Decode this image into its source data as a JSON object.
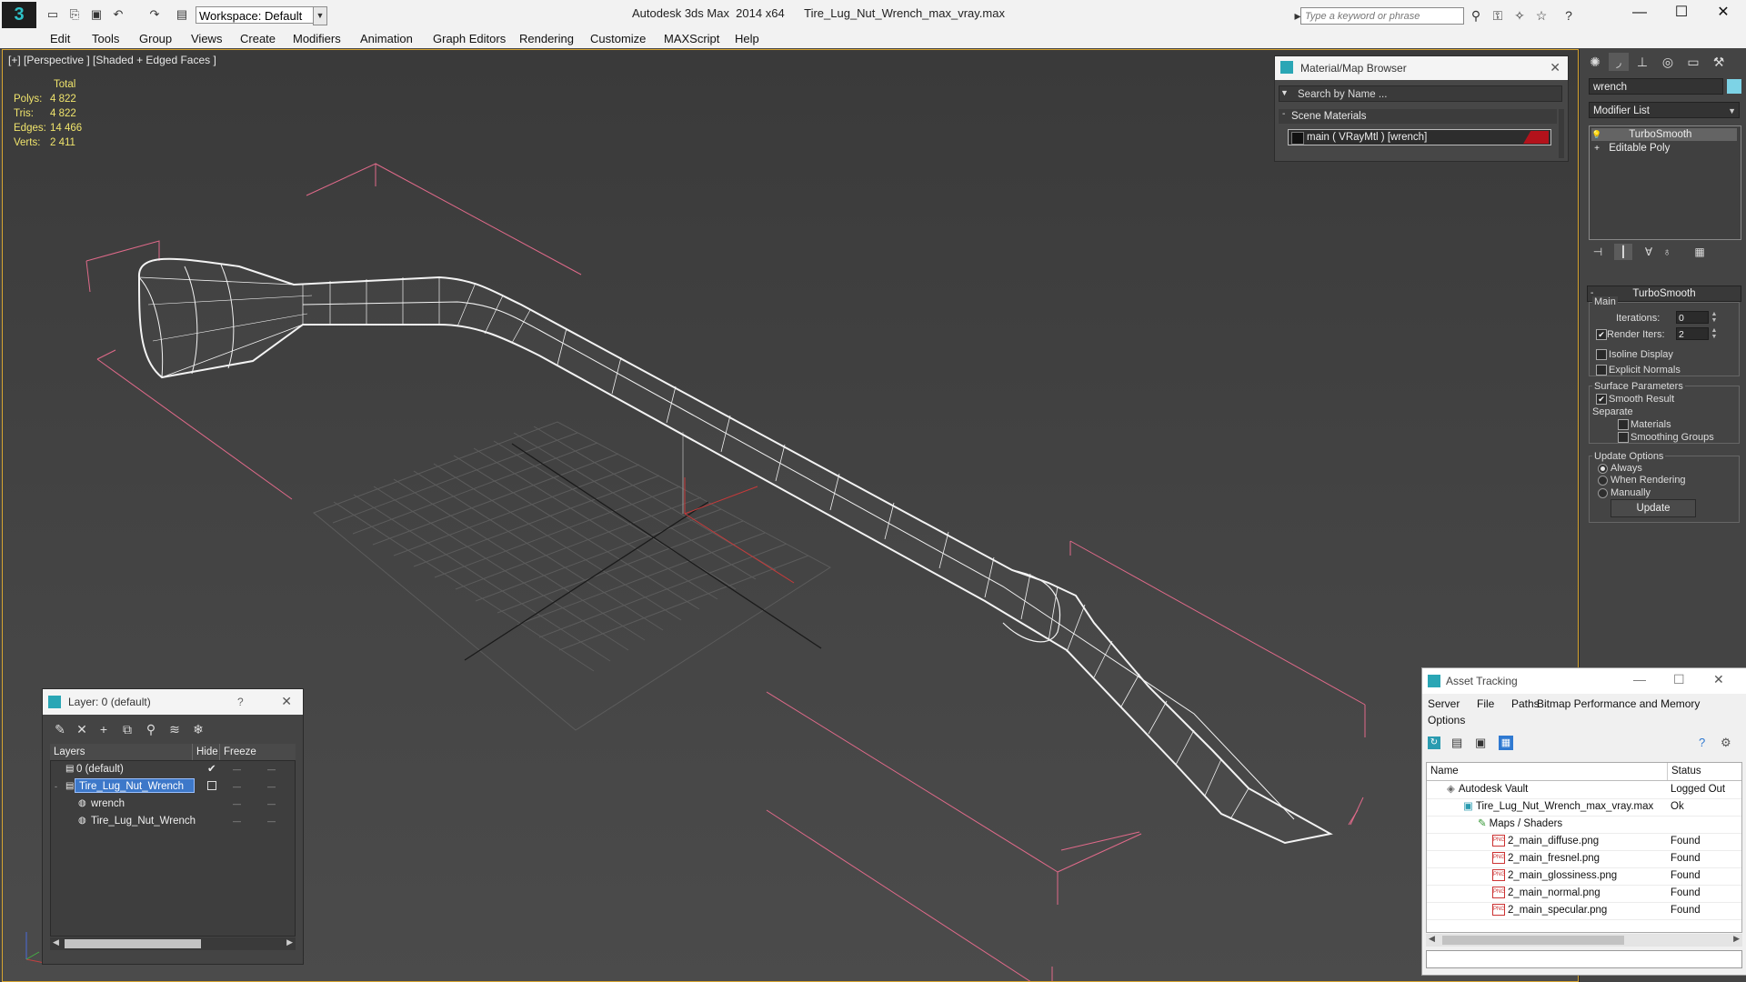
{
  "app": {
    "title": "Autodesk 3ds Max  2014 x64      Tire_Lug_Nut_Wrench_max_vray.max",
    "workspace": "Workspace: Default",
    "search_placeholder": "Type a keyword or phrase"
  },
  "menu": [
    "Edit",
    "Tools",
    "Group",
    "Views",
    "Create",
    "Modifiers",
    "Animation",
    "Graph Editors",
    "Rendering",
    "Customize",
    "MAXScript",
    "Help"
  ],
  "viewport": {
    "label": "[+] [Perspective ] [Shaded + Edged Faces ]",
    "stats": {
      "header": "Total",
      "rows": [
        {
          "label": "Polys:",
          "value": "4 822"
        },
        {
          "label": "Tris:",
          "value": "4 822"
        },
        {
          "label": "Edges:",
          "value": "14 466"
        },
        {
          "label": "Verts:",
          "value": "2 411"
        }
      ]
    }
  },
  "material_browser": {
    "title": "Material/Map Browser",
    "search": "Search by Name ...",
    "group": "Scene Materials",
    "item": "main  ( VRayMtl ) [wrench]"
  },
  "command_panel": {
    "object_name": "wrench",
    "modifier_list": "Modifier List",
    "stack": [
      "TurboSmooth",
      "Editable Poly"
    ],
    "rollout": "TurboSmooth",
    "main_label": "Main",
    "iterations_label": "Iterations:",
    "iterations_value": "0",
    "render_iters_label": "Render Iters:",
    "render_iters_value": "2",
    "isoline": "Isoline Display",
    "explicit": "Explicit Normals",
    "surface_params": "Surface Parameters",
    "smooth_result": "Smooth Result",
    "separate": "Separate",
    "materials": "Materials",
    "smoothing_groups": "Smoothing Groups",
    "update_options": "Update Options",
    "always": "Always",
    "when_rendering": "When Rendering",
    "manually": "Manually",
    "update_btn": "Update"
  },
  "layers": {
    "title": "Layer: 0 (default)",
    "help": "?",
    "columns": {
      "name": "Layers",
      "hide": "Hide",
      "freeze": "Freeze"
    },
    "rows": [
      "0 (default)",
      "Tire_Lug_Nut_Wrench",
      "wrench",
      "Tire_Lug_Nut_Wrench"
    ]
  },
  "asset": {
    "title": "Asset Tracking",
    "menu": [
      "Server",
      "File",
      "Paths",
      "Bitmap Performance and Memory",
      "Options"
    ],
    "columns": {
      "name": "Name",
      "status": "Status"
    },
    "rows": [
      {
        "name": "Autodesk Vault",
        "status": "Logged Out"
      },
      {
        "name": "Tire_Lug_Nut_Wrench_max_vray.max",
        "status": "Ok"
      },
      {
        "name": "Maps / Shaders",
        "status": ""
      },
      {
        "name": "2_main_diffuse.png",
        "status": "Found"
      },
      {
        "name": "2_main_fresnel.png",
        "status": "Found"
      },
      {
        "name": "2_main_glossiness.png",
        "status": "Found"
      },
      {
        "name": "2_main_normal.png",
        "status": "Found"
      },
      {
        "name": "2_main_specular.png",
        "status": "Found"
      }
    ]
  }
}
